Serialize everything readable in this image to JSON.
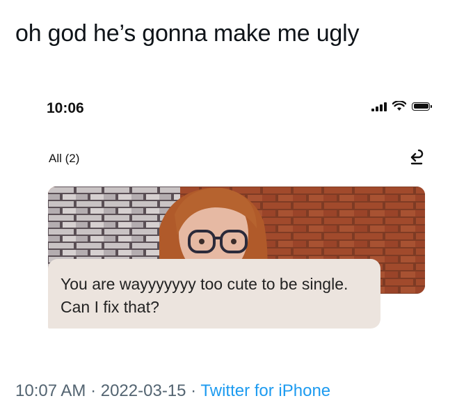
{
  "tweet": {
    "text": "oh god he’s gonna make me ugly",
    "timestamp": "10:07 AM",
    "separator1": " · ",
    "date": "2022-03-15",
    "separator2": " · ",
    "source": "Twitter for iPhone",
    "source_color": "#1d9bf0",
    "meta_color": "#536471"
  },
  "screenshot": {
    "status_bar": {
      "time": "10:06",
      "icons": [
        "signal-icon",
        "wifi-icon",
        "battery-icon"
      ]
    },
    "header": {
      "filter_label": "All (2)",
      "action_icon": "reply-arrow-icon"
    },
    "photo": {
      "icon": "profile-photo"
    },
    "message": {
      "text": "You are wayyyyyyy too cute to be single. Can I fix that?",
      "bubble_color": "#ece4de"
    }
  }
}
